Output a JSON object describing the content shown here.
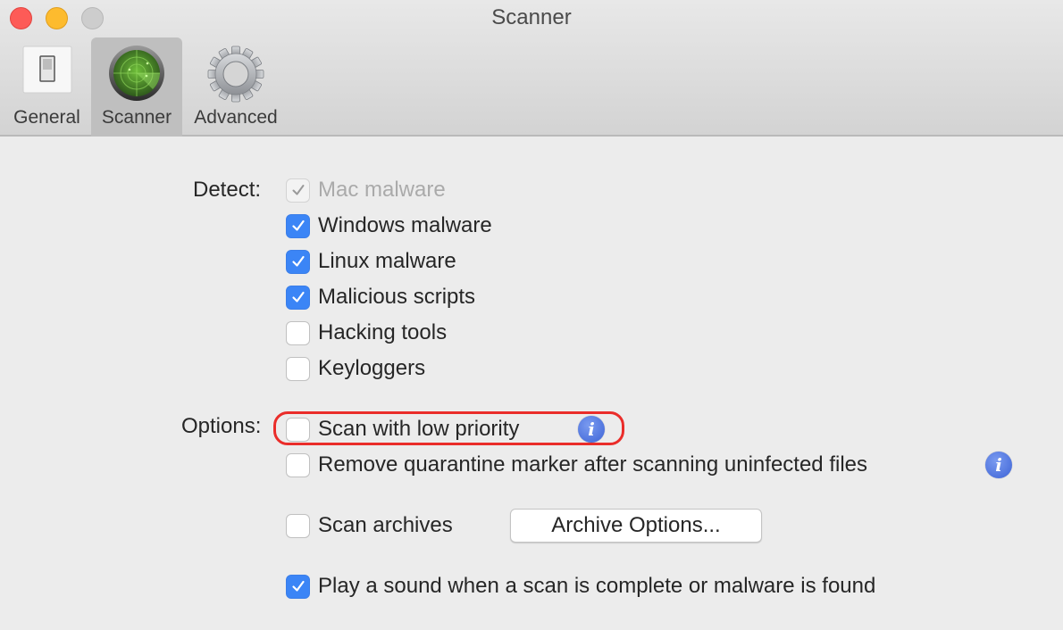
{
  "window": {
    "title": "Scanner",
    "traffic_lights": [
      "close",
      "minimize",
      "zoom"
    ]
  },
  "toolbar": {
    "tabs": [
      {
        "label": "General",
        "icon": "switch-icon",
        "active": false
      },
      {
        "label": "Scanner",
        "icon": "radar-icon",
        "active": true
      },
      {
        "label": "Advanced",
        "icon": "gear-icon",
        "active": false
      }
    ]
  },
  "detect": {
    "label": "Detect:",
    "items": [
      {
        "label": "Mac malware",
        "checked": true,
        "disabled": true
      },
      {
        "label": "Windows malware",
        "checked": true,
        "disabled": false
      },
      {
        "label": "Linux malware",
        "checked": true,
        "disabled": false
      },
      {
        "label": "Malicious scripts",
        "checked": true,
        "disabled": false
      },
      {
        "label": "Hacking tools",
        "checked": false,
        "disabled": false
      },
      {
        "label": "Keyloggers",
        "checked": false,
        "disabled": false
      }
    ]
  },
  "options": {
    "label": "Options:",
    "scan_low_priority": {
      "label": "Scan with low priority",
      "checked": false,
      "highlighted": true
    },
    "remove_quarantine": {
      "label": "Remove quarantine marker after scanning uninfected files",
      "checked": false
    },
    "scan_archives": {
      "label": "Scan archives",
      "checked": false
    },
    "archive_options_button": "Archive Options...",
    "play_sound": {
      "label": "Play a sound when a scan is complete or malware is found",
      "checked": true
    },
    "info_icon_glyph": "i"
  },
  "colors": {
    "accent": "#3b85f6",
    "highlight": "#ea2d2a",
    "info": "#4a6fdc"
  }
}
